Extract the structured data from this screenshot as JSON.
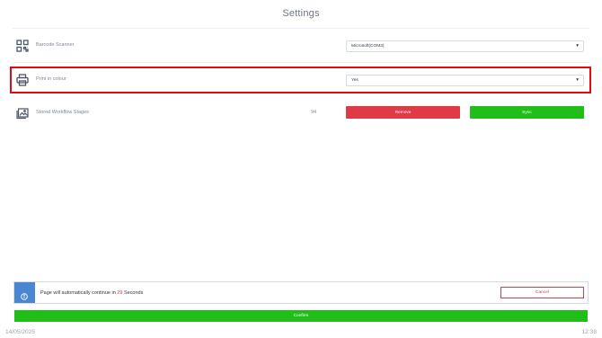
{
  "header": {
    "title": "Settings"
  },
  "settings": {
    "barcode": {
      "label": "Barcode Scanner",
      "icon": "qr-code-icon",
      "value": "Microsoft(COM3)"
    },
    "print": {
      "label": "Print in colour",
      "icon": "printer-icon",
      "value": "Yes"
    },
    "stored": {
      "label": "Stored Workflow Stages",
      "icon": "image-stack-icon",
      "count": "94",
      "remove_label": "Remove",
      "sync_label": "Sync"
    }
  },
  "notice": {
    "icon": "info-icon",
    "message_prefix": "Page will automatically continue in ",
    "seconds": "29",
    "message_suffix": " Seconds",
    "cancel_label": "Cancel"
  },
  "actions": {
    "confirm_label": "Confirm"
  },
  "footer": {
    "date": "14/05/2025",
    "time": "12:38"
  },
  "colors": {
    "accent_red": "#e03a47",
    "accent_green": "#21be1a",
    "highlight_red": "#e10b0f",
    "info_blue": "#4b86d1"
  }
}
